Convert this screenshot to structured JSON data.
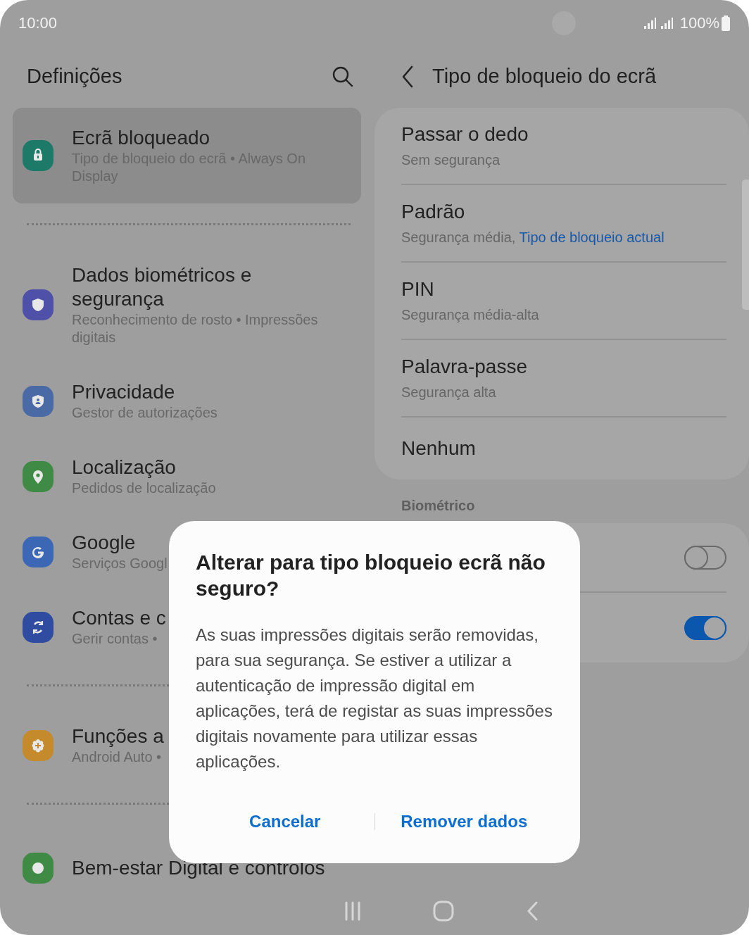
{
  "status_bar": {
    "time": "10:00",
    "battery": "100%"
  },
  "settings_pane": {
    "title": "Definições",
    "groups": [
      [
        {
          "title": "Ecrã bloqueado",
          "subtitle": "Tipo de bloqueio do ecrã  •  Always On Display",
          "selected": true,
          "color": "#1e7a68"
        }
      ],
      [
        {
          "title": "Dados biométricos e segurança",
          "subtitle": "Reconhecimento de rosto  •  Impressões digitais",
          "selected": false,
          "color": "#4f50a8"
        },
        {
          "title": "Privacidade",
          "subtitle": "Gestor de autorizações",
          "selected": false,
          "color": "#4a6aa6"
        },
        {
          "title": "Localização",
          "subtitle": "Pedidos de localização",
          "selected": false,
          "color": "#3f8a45"
        },
        {
          "title": "Google",
          "subtitle": "Serviços Googl",
          "selected": false,
          "color": "#3c67b4"
        },
        {
          "title": "Contas e c",
          "subtitle": "Gerir contas  •",
          "selected": false,
          "color": "#2f4ca0"
        }
      ],
      [
        {
          "title": "Funções a",
          "subtitle": "Android Auto  •",
          "selected": false,
          "color": "#c48a2c"
        }
      ],
      [
        {
          "title": "Bem-estar Digital e controlos",
          "selected": false,
          "color": "#3f8a45"
        }
      ]
    ]
  },
  "lock_pane": {
    "title": "Tipo de bloqueio do ecrã",
    "types": [
      {
        "title": "Passar o dedo",
        "subtitle": "Sem segurança"
      },
      {
        "title": "Padrão",
        "subtitle": "Segurança média,",
        "note": "Tipo de bloqueio actual"
      },
      {
        "title": "PIN",
        "subtitle": "Segurança média-alta"
      },
      {
        "title": "Palavra-passe",
        "subtitle": "Segurança alta"
      },
      {
        "title": "Nenhum"
      }
    ],
    "section": "Biométrico",
    "biometric_toggles": [
      {
        "on": false
      },
      {
        "on": true
      }
    ]
  },
  "dialog": {
    "title": "Alterar para tipo bloqueio ecrã não seguro?",
    "message": "As suas impressões digitais serão removidas, para sua segurança. Se estiver a utilizar a autenticação de impressão digital em aplicações, terá de registar as suas impressões digitais novamente para utilizar essas aplicações.",
    "buttons": [
      "Cancelar",
      "Remover dados"
    ]
  }
}
